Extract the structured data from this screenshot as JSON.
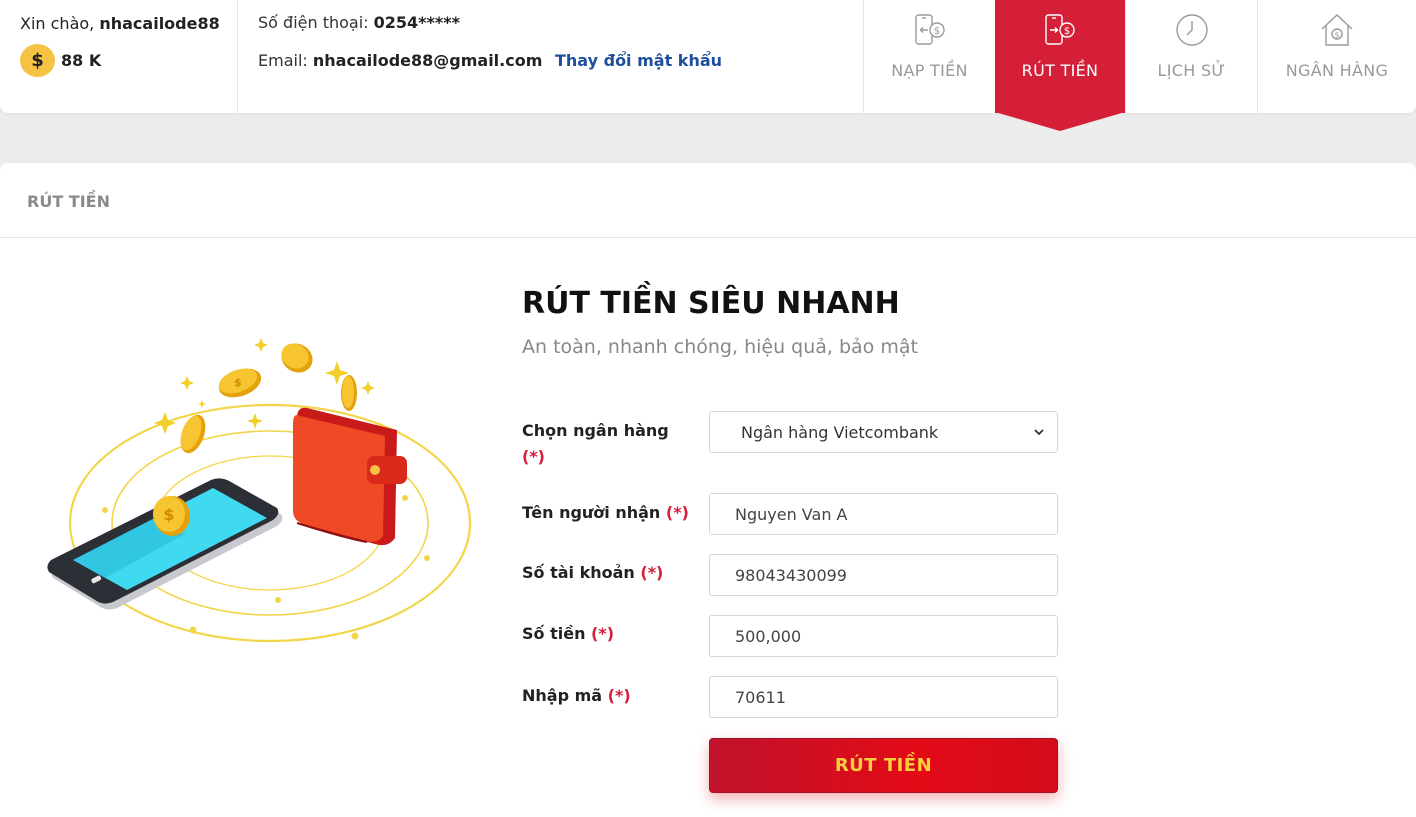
{
  "header": {
    "greeting_prefix": "Xin chào, ",
    "username": "nhacailode88",
    "coin_symbol": "$",
    "balance": "88 K",
    "phone_label": "Số điện thoại: ",
    "phone_value": "0254*****",
    "email_label": "Email: ",
    "email_value": "nhacailode88@gmail.com",
    "change_password": "Thay đổi mật khẩu"
  },
  "nav": [
    {
      "label": "NẠP TIỀN",
      "icon": "phone-deposit-icon",
      "active": false
    },
    {
      "label": "RÚT TIỀN",
      "icon": "phone-withdraw-icon",
      "active": true
    },
    {
      "label": "LỊCH SỬ",
      "icon": "clock-icon",
      "active": false
    },
    {
      "label": "NGÂN HÀNG",
      "icon": "bank-icon",
      "active": false
    }
  ],
  "card": {
    "header_title": "RÚT TIỀN",
    "form_title": "RÚT TIỀN SIÊU NHANH",
    "form_subtitle": "An toàn, nhanh chóng, hiệu quả, bảo mật"
  },
  "form": {
    "bank": {
      "label": "Chọn ngân hàng",
      "label_line2": "(*)",
      "value": "Ngân hàng Vietcombank"
    },
    "recipient": {
      "label": "Tên người nhận",
      "required": "(*)",
      "value": "Nguyen Van A"
    },
    "account": {
      "label": "Số tài khoản",
      "required": "(*)",
      "value": "98043430099"
    },
    "amount": {
      "label": "Số tiền",
      "required": "(*)",
      "value": "500,000"
    },
    "code": {
      "label": "Nhập mã",
      "required": "(*)",
      "value": "70611"
    },
    "submit_label": "RÚT TIỀN"
  },
  "colors": {
    "accent_red": "#d51e37",
    "link_blue": "#1f4e9c",
    "button_text_gold": "#f5d13b",
    "coin_gold": "#f6c244"
  }
}
